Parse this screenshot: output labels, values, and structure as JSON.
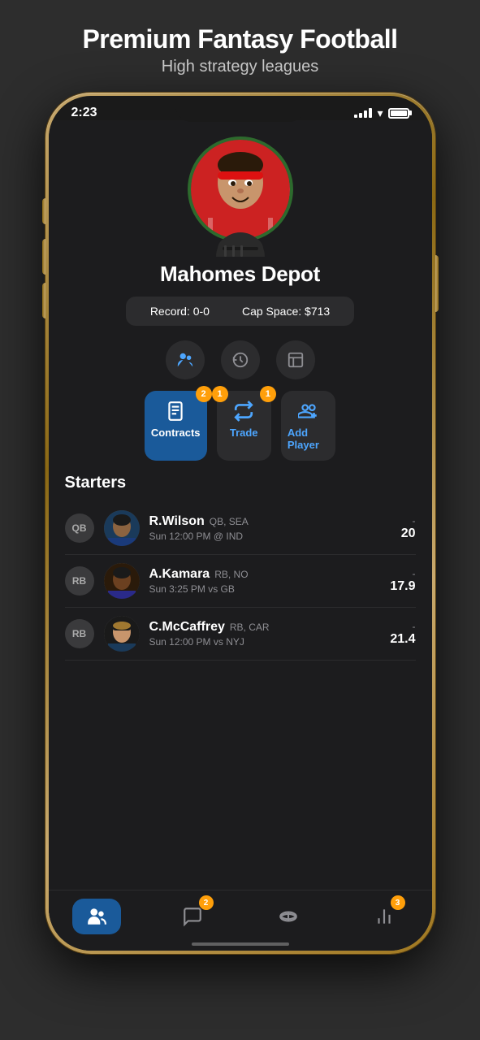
{
  "header": {
    "title": "Premium Fantasy Football",
    "subtitle": "High strategy leagues"
  },
  "status_bar": {
    "time": "2:23"
  },
  "team": {
    "name": "Mahomes Depot",
    "record_label": "Record:",
    "record_value": "0-0",
    "cap_label": "Cap Space:",
    "cap_value": "$713"
  },
  "tabs": {
    "players_label": "Players",
    "history_label": "History",
    "roster_label": "Roster"
  },
  "actions": {
    "contracts": {
      "label": "Contracts",
      "badge": "2"
    },
    "trade": {
      "label": "Trade",
      "badge_top": "1",
      "badge_side": "1"
    },
    "add_player": {
      "label": "Add Player"
    }
  },
  "starters": {
    "title": "Starters",
    "players": [
      {
        "position": "QB",
        "name": "R.Wilson",
        "pos_team": "QB, SEA",
        "game": "Sun 12:00 PM @ IND",
        "score_dash": "-",
        "score": "20"
      },
      {
        "position": "RB",
        "name": "A.Kamara",
        "pos_team": "RB, NO",
        "game": "Sun 3:25 PM vs GB",
        "score_dash": "-",
        "score": "17.9"
      },
      {
        "position": "RB",
        "name": "C.McCaffrey",
        "pos_team": "RB, CAR",
        "game": "Sun 12:00 PM vs NYJ",
        "score_dash": "-",
        "score": "21.4"
      }
    ]
  },
  "bottom_nav": {
    "items": [
      {
        "label": "Team",
        "active": true
      },
      {
        "label": "Chat",
        "badge": "2",
        "active": false
      },
      {
        "label": "League",
        "badge": "",
        "active": false
      },
      {
        "label": "Stats",
        "badge": "3",
        "active": false
      }
    ]
  },
  "colors": {
    "accent_blue": "#1a5a9a",
    "badge_orange": "#ff9f0a",
    "text_white": "#ffffff",
    "text_gray": "#8e8e93",
    "bg_dark": "#1c1c1e",
    "bg_card": "#2c2c2e"
  }
}
